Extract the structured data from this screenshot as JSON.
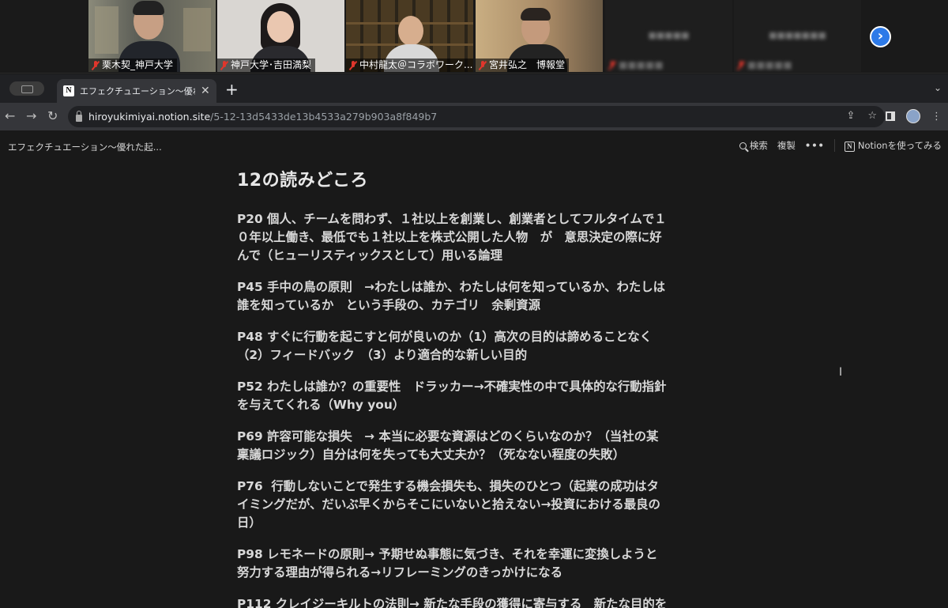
{
  "meeting": {
    "participants": [
      {
        "name": "栗木契_神戸大学"
      },
      {
        "name": "神戸大学･吉田満梨"
      },
      {
        "name": "中村龍太＠コラボワーク..."
      },
      {
        "name": "宮井弘之　博報堂"
      }
    ]
  },
  "browser": {
    "tab_title": "エフェクチュエーション〜優れた起",
    "url_host": "hiroyukimiyai.notion.site",
    "url_path": "/5-12-13d5433de13b4533a279b903a8f849b7"
  },
  "notion": {
    "breadcrumb": "エフェクチュエーション〜優れた起...",
    "search_label": "検索",
    "duplicate_label": "複製",
    "try_label": "Notionを使ってみる",
    "page_title": "12の読みどころ",
    "entries": [
      "P20 個人、チームを問わず、１社以上を創業し、創業者としてフルタイムで１\n０年以上働き、最低でも１社以上を株式公開した人物　が　意思決定の際に好\nんで（ヒューリスティックスとして）用いる論理",
      "P45 手中の鳥の原則　→わたしは誰か、わたしは何を知っているか、わたしは\n誰を知っているか　という手段の、カテゴリ　余剰資源",
      "P48 すぐに行動を起こすと何が良いのか（1）高次の目的は諦めることなく\n（2）フィードバック　（3）より適合的な新しい目的",
      "P52 わたしは誰か？の重要性　ドラッカー→不確実性の中で具体的な行動指針\nを与えてくれる（Why you）",
      "P69 許容可能な損失　→ 本当に必要な資源はどのくらいなのか？（当社の某\n稟議ロジック）自分は何を失っても大丈夫か？（死なない程度の失敗）",
      "P76  行動しないことで発生する機会損失も、損失のひとつ（起業の成功はタ\nイミングだが、だいぶ早くからそこにいないと拾えない→投資における最良の\n日）",
      "P98 レモネードの原則→ 予期せぬ事態に気づき、それを幸運に変換しようと\n努力する理由が得られる→リフレーミングのきっかけになる",
      "P112 クレイジーキルトの法則→ 新たな手段の獲得に寄与する　新たな目的を"
    ]
  }
}
